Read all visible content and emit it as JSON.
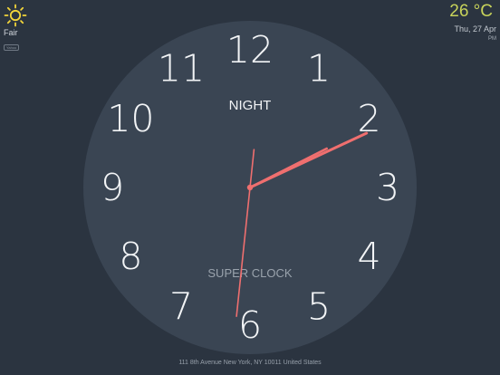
{
  "weather": {
    "icon": "sun-icon",
    "icon_color": "#f3d53a",
    "condition": "Fair",
    "source_badge": "Yahoo"
  },
  "status": {
    "temperature": "26 °C",
    "date": "Thu, 27 Apr",
    "ampm": "PM"
  },
  "clock": {
    "mode_label": "NIGHT",
    "brand_label": "SUPER CLOCK",
    "numerals": [
      "12",
      "1",
      "2",
      "3",
      "4",
      "5",
      "6",
      "7",
      "8",
      "9",
      "10",
      "11"
    ],
    "time": {
      "hour": 2,
      "minute": 10,
      "second": 31
    },
    "hand_color": "#ef6f6f",
    "face_color": "#3a4553",
    "numeral_color": "#f2f4f6"
  },
  "footer": {
    "address": "111 8th Avenue New York, NY 10011 United States"
  }
}
